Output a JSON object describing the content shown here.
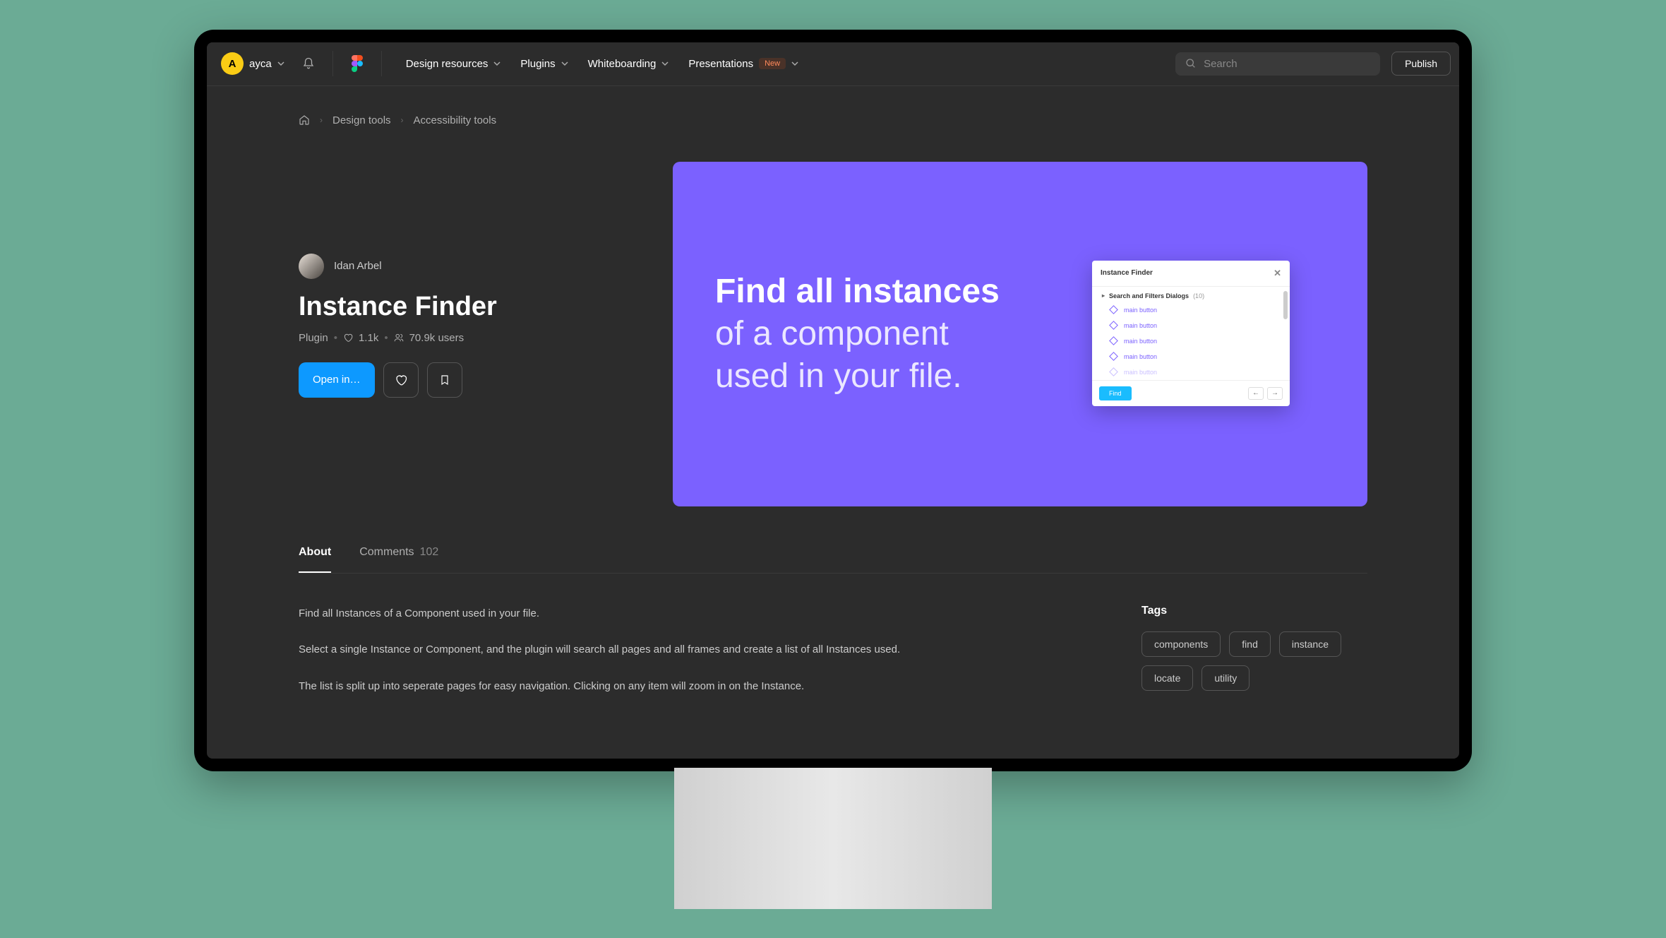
{
  "header": {
    "user_initial": "A",
    "username": "ayca",
    "nav": [
      {
        "label": "Design resources"
      },
      {
        "label": "Plugins"
      },
      {
        "label": "Whiteboarding"
      },
      {
        "label": "Presentations",
        "badge": "New"
      }
    ],
    "search_placeholder": "Search",
    "publish_label": "Publish"
  },
  "breadcrumb": {
    "items": [
      "Design tools",
      "Accessibility tools"
    ]
  },
  "plugin": {
    "author": "Idan Arbel",
    "title": "Instance Finder",
    "type": "Plugin",
    "likes": "1.1k",
    "users": "70.9k users",
    "open_label": "Open in…"
  },
  "hero": {
    "line_bold": "Find all instances",
    "line_rest_1": " of a component used in your file.",
    "panel": {
      "title": "Instance Finder",
      "group_label": "Search and Filters Dialogs",
      "group_count": "(10)",
      "items": [
        "main button",
        "main button",
        "main button",
        "main button",
        "main button"
      ],
      "find_label": "Find"
    }
  },
  "tabs": {
    "about": "About",
    "comments_label": "Comments",
    "comments_count": "102"
  },
  "description": {
    "p1": "Find all Instances of a Component used in your file.",
    "p2": "Select a single Instance or Component, and the plugin will search all pages and all frames and create a list of all Instances used.",
    "p3": "The list is split up into seperate pages for easy navigation. Clicking on any item will zoom in on the Instance."
  },
  "tags": {
    "title": "Tags",
    "items": [
      "components",
      "find",
      "instance",
      "locate",
      "utility"
    ]
  }
}
